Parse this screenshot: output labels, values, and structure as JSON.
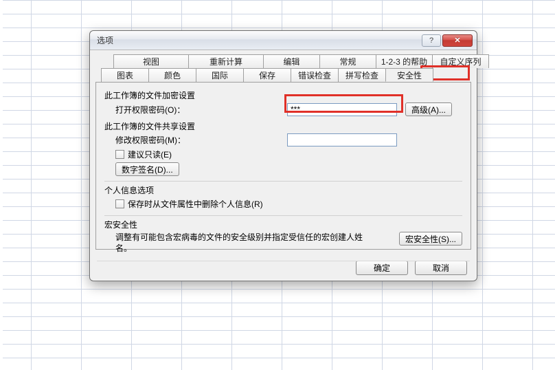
{
  "dialog": {
    "title": "选项",
    "help_glyph": "?",
    "close_glyph": "✕"
  },
  "tabs_row1": {
    "shitu": "视图",
    "chongxin": "重新计算",
    "bianji": "编辑",
    "changgui": "常规",
    "help123": "1-2-3 的帮助",
    "zidingyi": "自定义序列"
  },
  "tabs_row2": {
    "tubiao": "图表",
    "yanse": "颜色",
    "guoji": "国际",
    "baocun": "保存",
    "cuowu": "错误检查",
    "pinxie": "拼写检查",
    "anquan": "安全性"
  },
  "panel": {
    "encrypt_heading": "此工作簿的文件加密设置",
    "open_pw_label": "打开权限密码(O)：",
    "open_pw_value": "***",
    "advanced_btn": "高级(A)...",
    "share_heading": "此工作簿的文件共享设置",
    "modify_pw_label": "修改权限密码(M)：",
    "modify_pw_value": "",
    "readonly_label": "建议只读(E)",
    "digsig_btn": "数字签名(D)...",
    "personal_heading": "个人信息选项",
    "remove_personal_label": "保存时从文件属性中删除个人信息(R)",
    "macro_heading": "宏安全性",
    "macro_desc": "调整有可能包含宏病毒的文件的安全级别并指定受信任的宏创建人姓名。",
    "macro_btn": "宏安全性(S)..."
  },
  "footer": {
    "ok": "确定",
    "cancel": "取消"
  }
}
